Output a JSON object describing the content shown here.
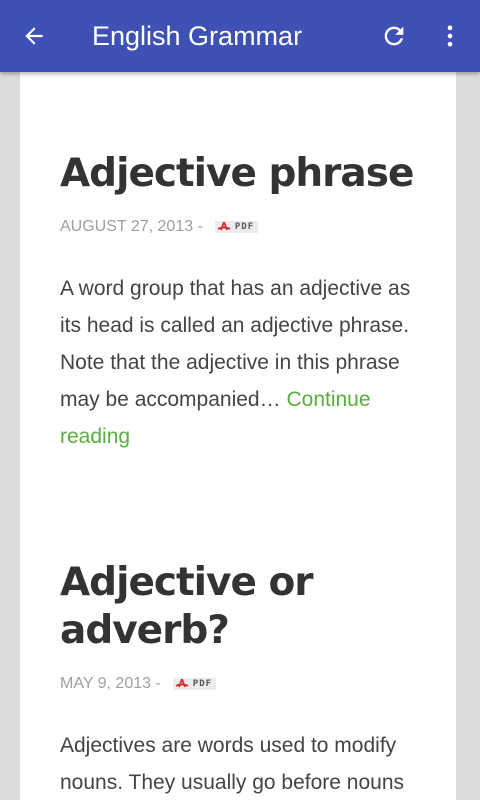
{
  "appbar": {
    "title": "English Grammar",
    "back_icon": "arrow-left-icon",
    "refresh_icon": "refresh-icon",
    "more_icon": "more-vert-icon",
    "color": "#3f51b5"
  },
  "posts": [
    {
      "title": "Adjective phrase",
      "date": "AUGUST 27, 2013 -",
      "pdf_label": "PDF",
      "excerpt": "A word group that has an adjective as its head is called an adjective phrase. Note that the adjective in this phrase may be accompanied…",
      "continue_label": "Continue reading"
    },
    {
      "title": "Adjective or adverb?",
      "date": "MAY 9, 2013 -",
      "pdf_label": "PDF",
      "excerpt": "Adjectives are words used to modify nouns. They usually go before nouns"
    }
  ],
  "colors": {
    "link": "#5aae3f",
    "background": "#dcdcdc",
    "card": "#ffffff"
  }
}
